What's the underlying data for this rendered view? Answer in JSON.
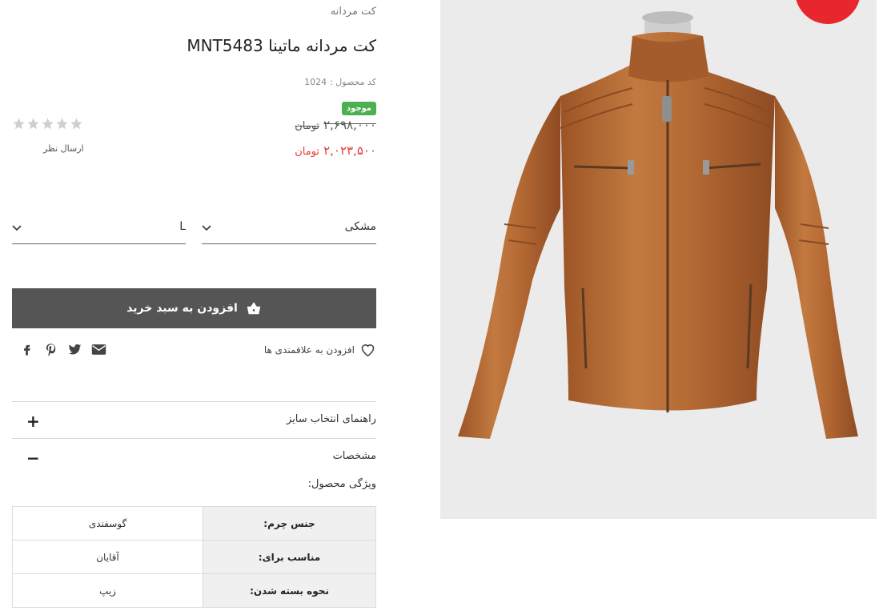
{
  "breadcrumb": {
    "category": "کت مردانه"
  },
  "product": {
    "title": "کت مردانه ماتینا MNT5483",
    "sku_label": "کد محصول :",
    "sku_value": "1024",
    "stock": "موجود",
    "old_price": "۲,۶۹۸,۰۰۰",
    "new_price": "۲,۰۲۳,۵۰۰",
    "currency": "تومان",
    "rating": 0,
    "rating_max": 5,
    "review_link": "ارسال نظر"
  },
  "options": {
    "color_value": "مشکی",
    "size_value": "L"
  },
  "actions": {
    "add_to_cart": "افزودن به سبد خرید",
    "wishlist": "افزودن به علاقمندی ها"
  },
  "share": {
    "icons": [
      "mail-icon",
      "twitter-icon",
      "pinterest-icon",
      "facebook-icon"
    ]
  },
  "accordion": {
    "size_guide": {
      "label": "راهنمای انتخاب سایز",
      "sign": "+"
    },
    "specs": {
      "label": "مشخصات",
      "sign": "−"
    }
  },
  "features": {
    "title": "ویژگی محصول:",
    "rows": [
      {
        "key": "جنس چرم:",
        "value": "گوسفندی"
      },
      {
        "key": "مناسب برای:",
        "value": "آقایان"
      },
      {
        "key": "نحوه بسته شدن:",
        "value": "زیپ"
      }
    ]
  },
  "colors": {
    "accent_green": "#4caf50",
    "price_red": "#e53935",
    "button_gray": "#555555",
    "sale_red": "#e8262d",
    "leather": "#b56a34"
  }
}
